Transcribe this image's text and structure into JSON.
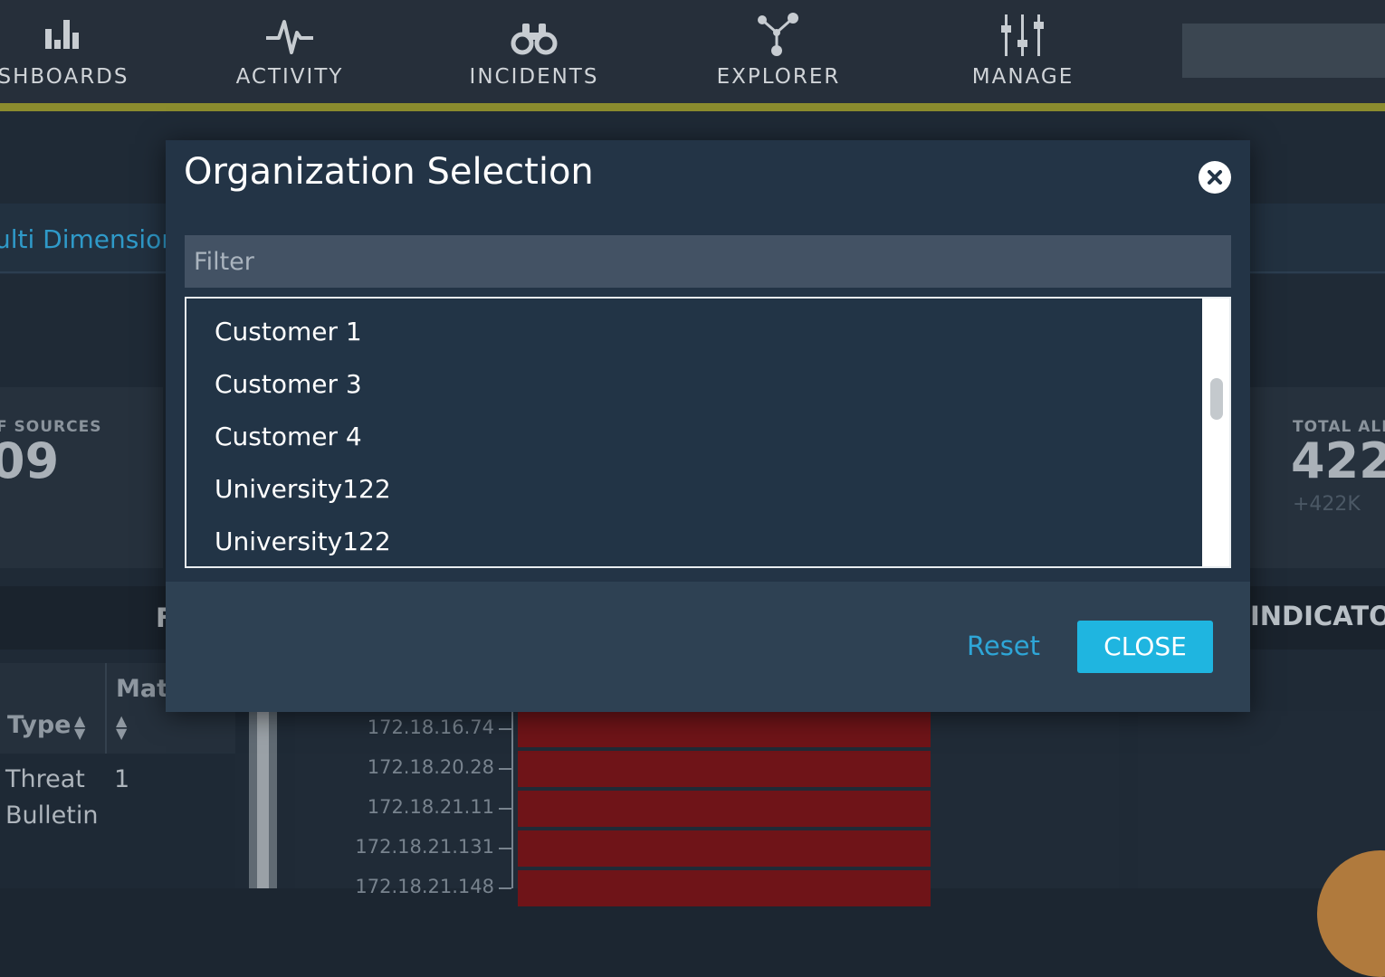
{
  "nav": {
    "items": [
      {
        "label": "SHBOARDS",
        "icon": "bar-chart-icon"
      },
      {
        "label": "ACTIVITY",
        "icon": "pulse-icon"
      },
      {
        "label": "INCIDENTS",
        "icon": "binoculars-icon"
      },
      {
        "label": "EXPLORER",
        "icon": "network-icon"
      },
      {
        "label": "MANAGE",
        "icon": "sliders-icon"
      }
    ],
    "accent_color": "#8b8c2e"
  },
  "background": {
    "tab_text": "ulti Dimension",
    "stats": {
      "sources_label": "F SOURCES",
      "sources_value": "09",
      "alerts_label": "TOTAL ALE",
      "alerts_value": "422",
      "alerts_sub": "+422K"
    },
    "section_left_title": "F",
    "section_right_title": "INDICATOR",
    "table": {
      "col_type": "Type",
      "col_mat": "Mat",
      "row_type_line1": "Threat",
      "row_type_line2": "Bulletin",
      "row_value": "1"
    },
    "bars": {
      "labels": [
        "172.18.16.74",
        "172.18.20.28",
        "172.18.21.11",
        "172.18.21.131",
        "172.18.21.148"
      ],
      "color": "#6f1418"
    }
  },
  "modal": {
    "title": "Organization Selection",
    "filter_placeholder": "Filter",
    "organizations": [
      "Customer 1",
      "Customer 3",
      "Customer 4",
      "University122",
      "University122"
    ],
    "reset_label": "Reset",
    "close_label": "CLOSE",
    "primary_color": "#1fb5e0"
  }
}
